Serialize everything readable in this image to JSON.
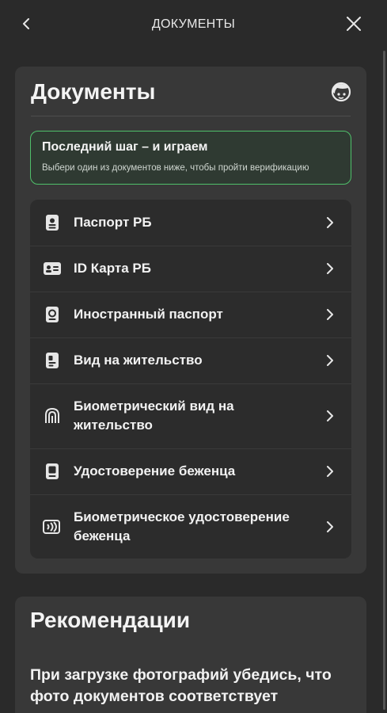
{
  "header": {
    "title": "ДОКУМЕНТЫ",
    "back_icon": "chevron-left-icon",
    "close_icon": "close-icon"
  },
  "documents_card": {
    "title": "Документы",
    "support_icon": "support-face-icon",
    "banner": {
      "title": "Последний шаг – и играем",
      "subtitle": "Выбери один из документов ниже, чтобы пройти верификацию",
      "border_color": "#4fc06a"
    },
    "items": [
      {
        "label": "Паспорт РБ",
        "icon": "passport-icon"
      },
      {
        "label": "ID Карта РБ",
        "icon": "id-card-icon"
      },
      {
        "label": "Иностранный паспорт",
        "icon": "foreign-passport-icon"
      },
      {
        "label": "Вид на жительство",
        "icon": "residence-permit-icon"
      },
      {
        "label": "Биометрический вид на жительство",
        "icon": "biometric-icon"
      },
      {
        "label": "Удостоверение беженца",
        "icon": "refugee-certificate-icon"
      },
      {
        "label": "Биометрическое удостоверение беженца",
        "icon": "biometric-contactless-icon"
      }
    ]
  },
  "recommendations_card": {
    "title": "Рекомендации",
    "text": "При загрузке фотографий убедись, что фото документов соответствует"
  }
}
